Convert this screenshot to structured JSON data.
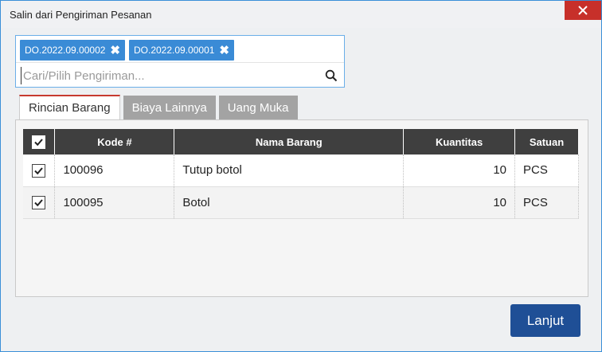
{
  "window": {
    "title": "Salin dari Pengiriman Pesanan"
  },
  "selector": {
    "tags": [
      "DO.2022.09.00002",
      "DO.2022.09.00001"
    ],
    "placeholder": "Cari/Pilih Pengiriman..."
  },
  "tabs": [
    {
      "label": "Rincian Barang",
      "active": true
    },
    {
      "label": "Biaya Lainnya",
      "active": false
    },
    {
      "label": "Uang Muka",
      "active": false
    }
  ],
  "table": {
    "headers": [
      "Kode #",
      "Nama Barang",
      "Kuantitas",
      "Satuan"
    ],
    "rows": [
      {
        "checked": true,
        "kode": "100096",
        "nama": "Tutup botol",
        "kuantitas": "10",
        "satuan": "PCS"
      },
      {
        "checked": true,
        "kode": "100095",
        "nama": "Botol",
        "kuantitas": "10",
        "satuan": "PCS"
      }
    ]
  },
  "footer": {
    "next_label": "Lanjut"
  },
  "colors": {
    "accent": "#3a8bd6",
    "primary_button": "#1f4f96",
    "close": "#c7302a",
    "header": "#3f3f3f"
  }
}
